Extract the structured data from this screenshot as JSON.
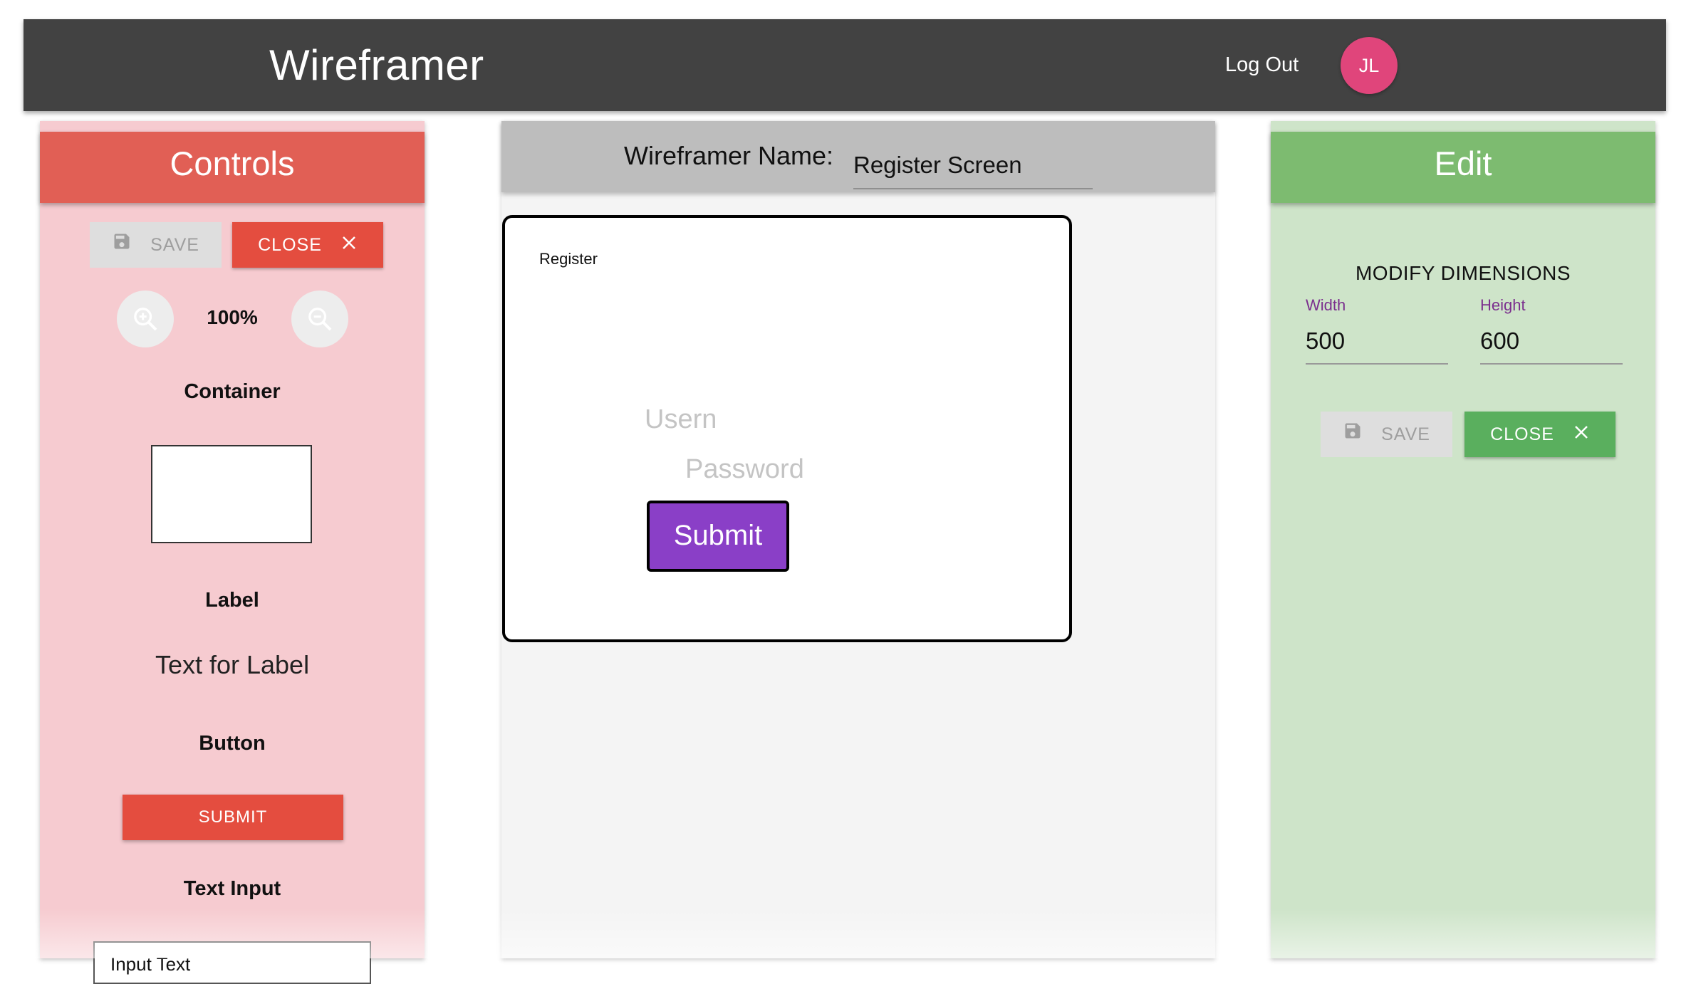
{
  "navbar": {
    "brand": "Wireframer",
    "logout_label": "Log Out",
    "avatar_initials": "JL"
  },
  "controls": {
    "title": "Controls",
    "save_label": "SAVE",
    "close_label": "CLOSE",
    "zoom_level": "100%",
    "container_title": "Container",
    "label_title": "Label",
    "label_sample_text": "Text for Label",
    "button_title": "Button",
    "button_sample_label": "SUBMIT",
    "text_input_title": "Text Input",
    "text_input_sample_value": "Input Text"
  },
  "editor": {
    "name_label": "Wireframer Name:",
    "name_value": "Register Screen",
    "canvas": {
      "label_text": "Register",
      "username_placeholder": "Usern",
      "password_placeholder": "Password",
      "submit_label": "Submit"
    }
  },
  "edit": {
    "title": "Edit",
    "modify_title": "MODIFY DIMENSIONS",
    "width_label": "Width",
    "width_value": "500",
    "height_label": "Height",
    "height_value": "600",
    "save_label": "SAVE",
    "close_label": "CLOSE"
  },
  "colors": {
    "navbar": "#424242",
    "controls_header": "#e15f55",
    "controls_bg": "#f6cbd0",
    "edit_header": "#7dbb70",
    "edit_bg": "#cee4c9",
    "canvas_submit": "#8a3fc7",
    "avatar": "#e0457b"
  },
  "icons": [
    "save-icon",
    "close-icon",
    "zoom-in-icon",
    "zoom-out-icon"
  ]
}
